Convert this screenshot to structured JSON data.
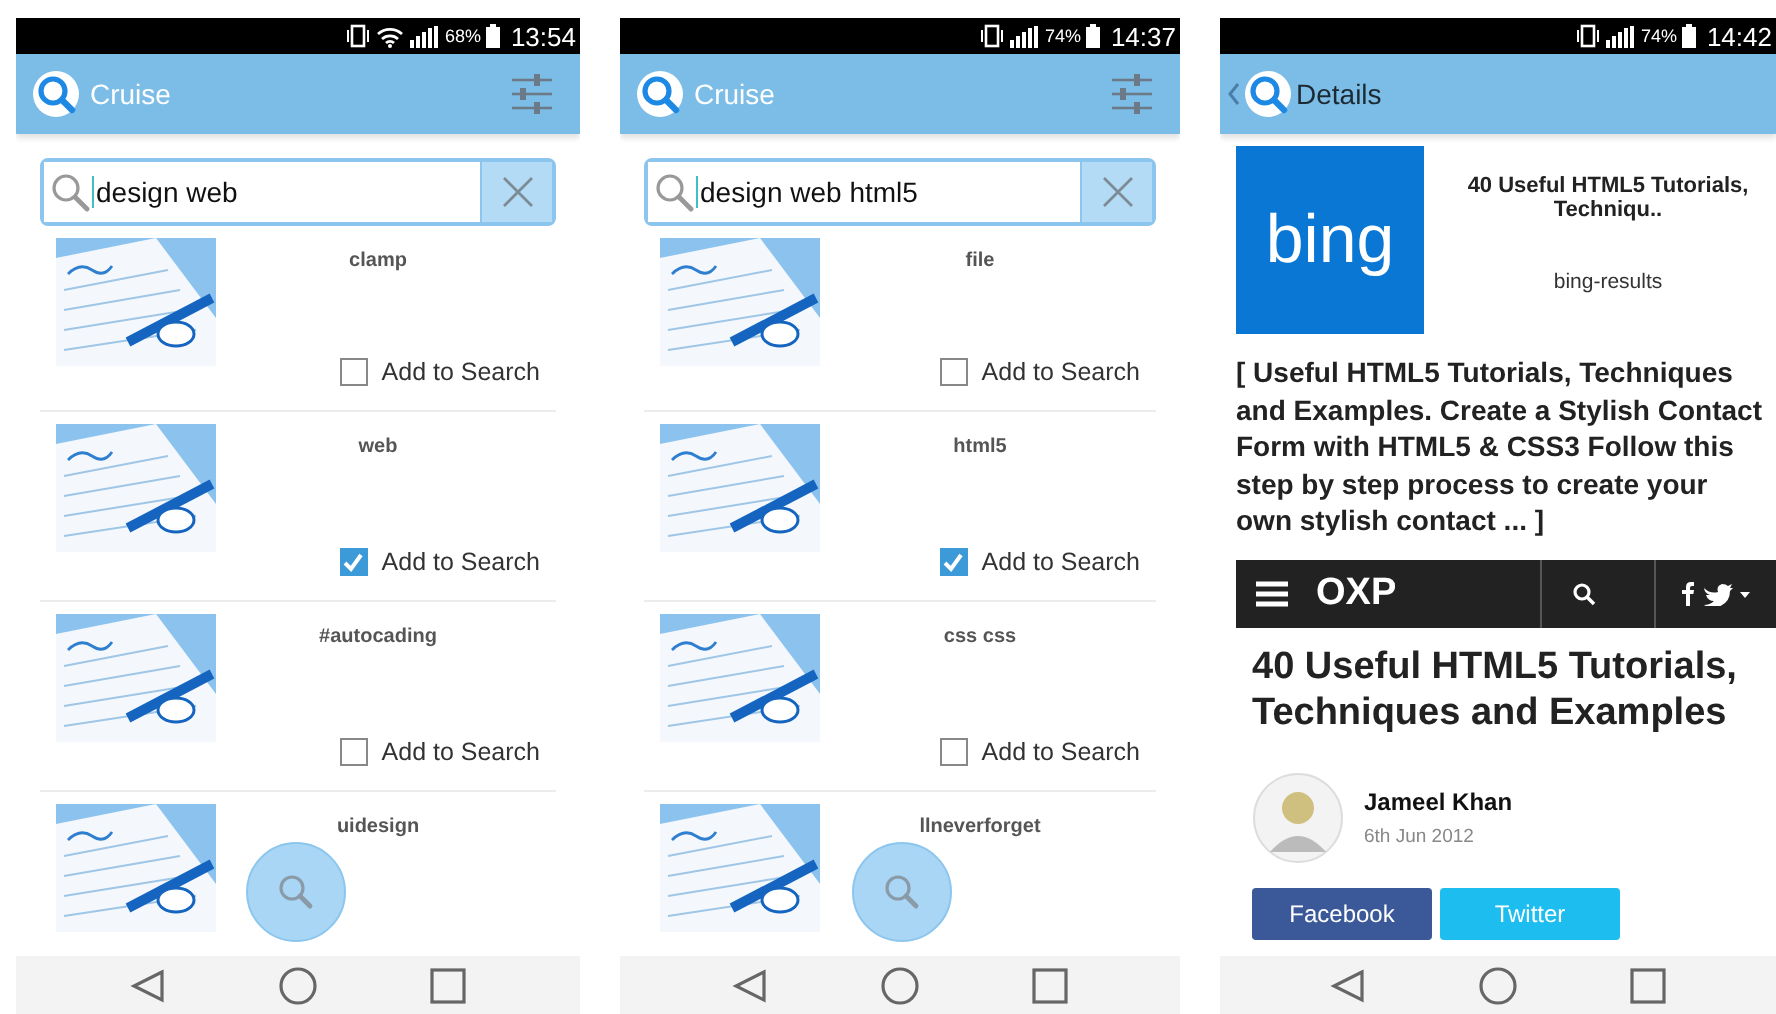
{
  "screens": [
    {
      "kind": "search",
      "status": {
        "wifi": true,
        "battery": "68%",
        "time": "13:54"
      },
      "app_bar": {
        "title": "Cruise"
      },
      "search": {
        "value": "design web"
      },
      "results": [
        {
          "tag": "clamp",
          "checkbox_label": "Add to Search",
          "checked": false
        },
        {
          "tag": "web",
          "checkbox_label": "Add to Search",
          "checked": true
        },
        {
          "tag": "#autocading",
          "checkbox_label": "Add to Search",
          "checked": false
        },
        {
          "tag": "uidesign"
        }
      ]
    },
    {
      "kind": "search",
      "status": {
        "wifi": false,
        "battery": "74%",
        "time": "14:37"
      },
      "app_bar": {
        "title": "Cruise"
      },
      "search": {
        "value": "design web html5"
      },
      "results": [
        {
          "tag": "file",
          "checkbox_label": "Add to Search",
          "checked": false
        },
        {
          "tag": "html5",
          "checkbox_label": "Add to Search",
          "checked": true
        },
        {
          "tag": "css css",
          "checkbox_label": "Add to Search",
          "checked": false
        },
        {
          "tag": "llneverforget"
        }
      ]
    },
    {
      "kind": "details",
      "status": {
        "wifi": false,
        "battery": "74%",
        "time": "14:42"
      },
      "app_bar": {
        "title": "Details"
      },
      "result": {
        "logo": "bing",
        "title": "40 Useful HTML5 Tutorials, Techniqu..",
        "source": "bing-results",
        "snippet": "[ Useful HTML5 Tutorials, Techniques and Examples. Create a Stylish Contact Form with HTML5 & CSS3 Follow this step by step process to create your own stylish contact ... ]"
      },
      "webpage": {
        "logo": "OXP",
        "headline": "40 Useful HTML5 Tutorials, Techniques and Examples",
        "author": "Jameel Khan",
        "date": "6th Jun 2012",
        "share_buttons": [
          "Facebook",
          "Twitter"
        ]
      }
    }
  ]
}
